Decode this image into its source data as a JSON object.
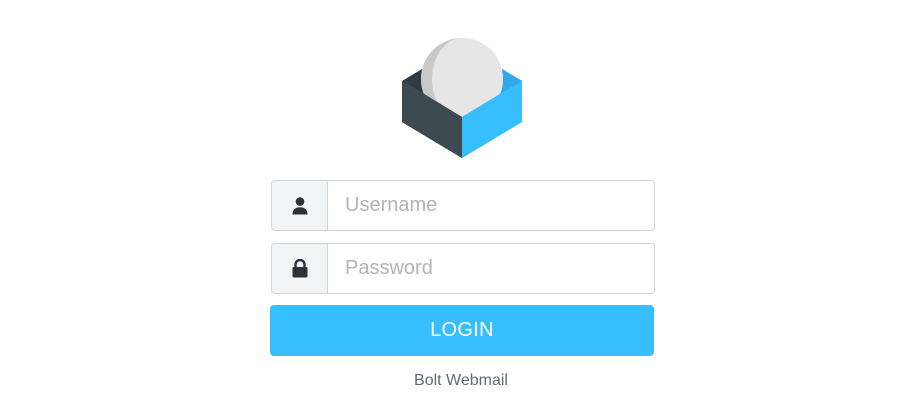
{
  "app": {
    "logo_name": "roundcube-logo",
    "brand_color": "#37beff"
  },
  "login_form": {
    "username": {
      "placeholder": "Username",
      "value": "",
      "icon": "user-icon"
    },
    "password": {
      "placeholder": "Password",
      "value": "",
      "icon": "lock-icon"
    },
    "submit_label": "LOGIN"
  },
  "footer": {
    "product_name": "Bolt Webmail"
  }
}
